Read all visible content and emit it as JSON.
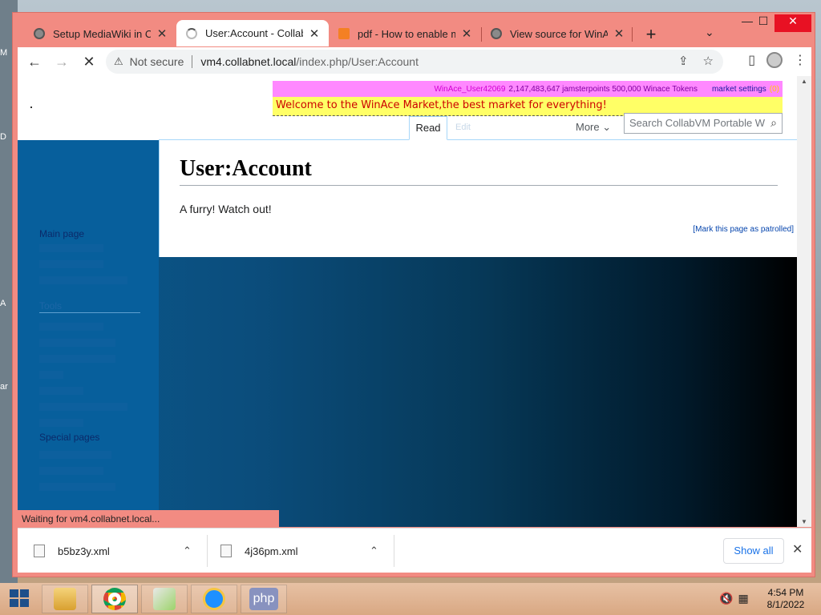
{
  "browser": {
    "tabs": [
      {
        "title": "Setup MediaWiki in Col",
        "favicon": "globe-icon",
        "active": false
      },
      {
        "title": "User:Account - CollabV",
        "favicon": "loading-spinner-icon",
        "active": true
      },
      {
        "title": "pdf - How to enable mb",
        "favicon": "stackoverflow-icon",
        "active": false
      },
      {
        "title": "View source for WinAce",
        "favicon": "globe-icon",
        "active": false
      }
    ],
    "new_tab_label": "+",
    "tab_menu_label": "⌄",
    "window_controls": {
      "minimize": "—",
      "maximize": "☐",
      "close": "✕"
    },
    "toolbar": {
      "back": "←",
      "forward": "→",
      "stop": "✕",
      "security_label": "Not secure",
      "url_host": "vm4.collabnet.local",
      "url_path": "/index.php/User:Account"
    }
  },
  "page": {
    "winace": {
      "user": "WinAce_User42069",
      "points": "2,147,483,647 jamsterpoints 500,000 Winace Tokens",
      "settings": "market settings",
      "badge": "(0)"
    },
    "welcome": "Welcome to the WinAce Market,the best market for everything!",
    "tabs": {
      "read": "Read",
      "edit": "Edit",
      "more": "More"
    },
    "search_placeholder": "Search CollabVM Portable W",
    "title": "User:Account",
    "body": "A furry! Watch out!",
    "patrol_link": "[Mark this page as patrolled]",
    "sidebar": {
      "main_page": "Main page",
      "tools_heading": "Tools",
      "special_pages": "Special pages"
    }
  },
  "status": "Waiting for vm4.collabnet.local...",
  "downloads": {
    "items": [
      {
        "name": "b5bz3y.xml"
      },
      {
        "name": "4j36pm.xml"
      }
    ],
    "show_all": "Show all",
    "close": "✕"
  },
  "taskbar": {
    "apps": [
      "file-explorer-icon",
      "chrome-icon",
      "notepad-icon",
      "internet-explorer-icon",
      "php-icon"
    ],
    "php_label": "php",
    "time": "4:54 PM",
    "date": "8/1/2022"
  },
  "desktop_labels": [
    "M",
    "D",
    "A",
    "ar"
  ]
}
